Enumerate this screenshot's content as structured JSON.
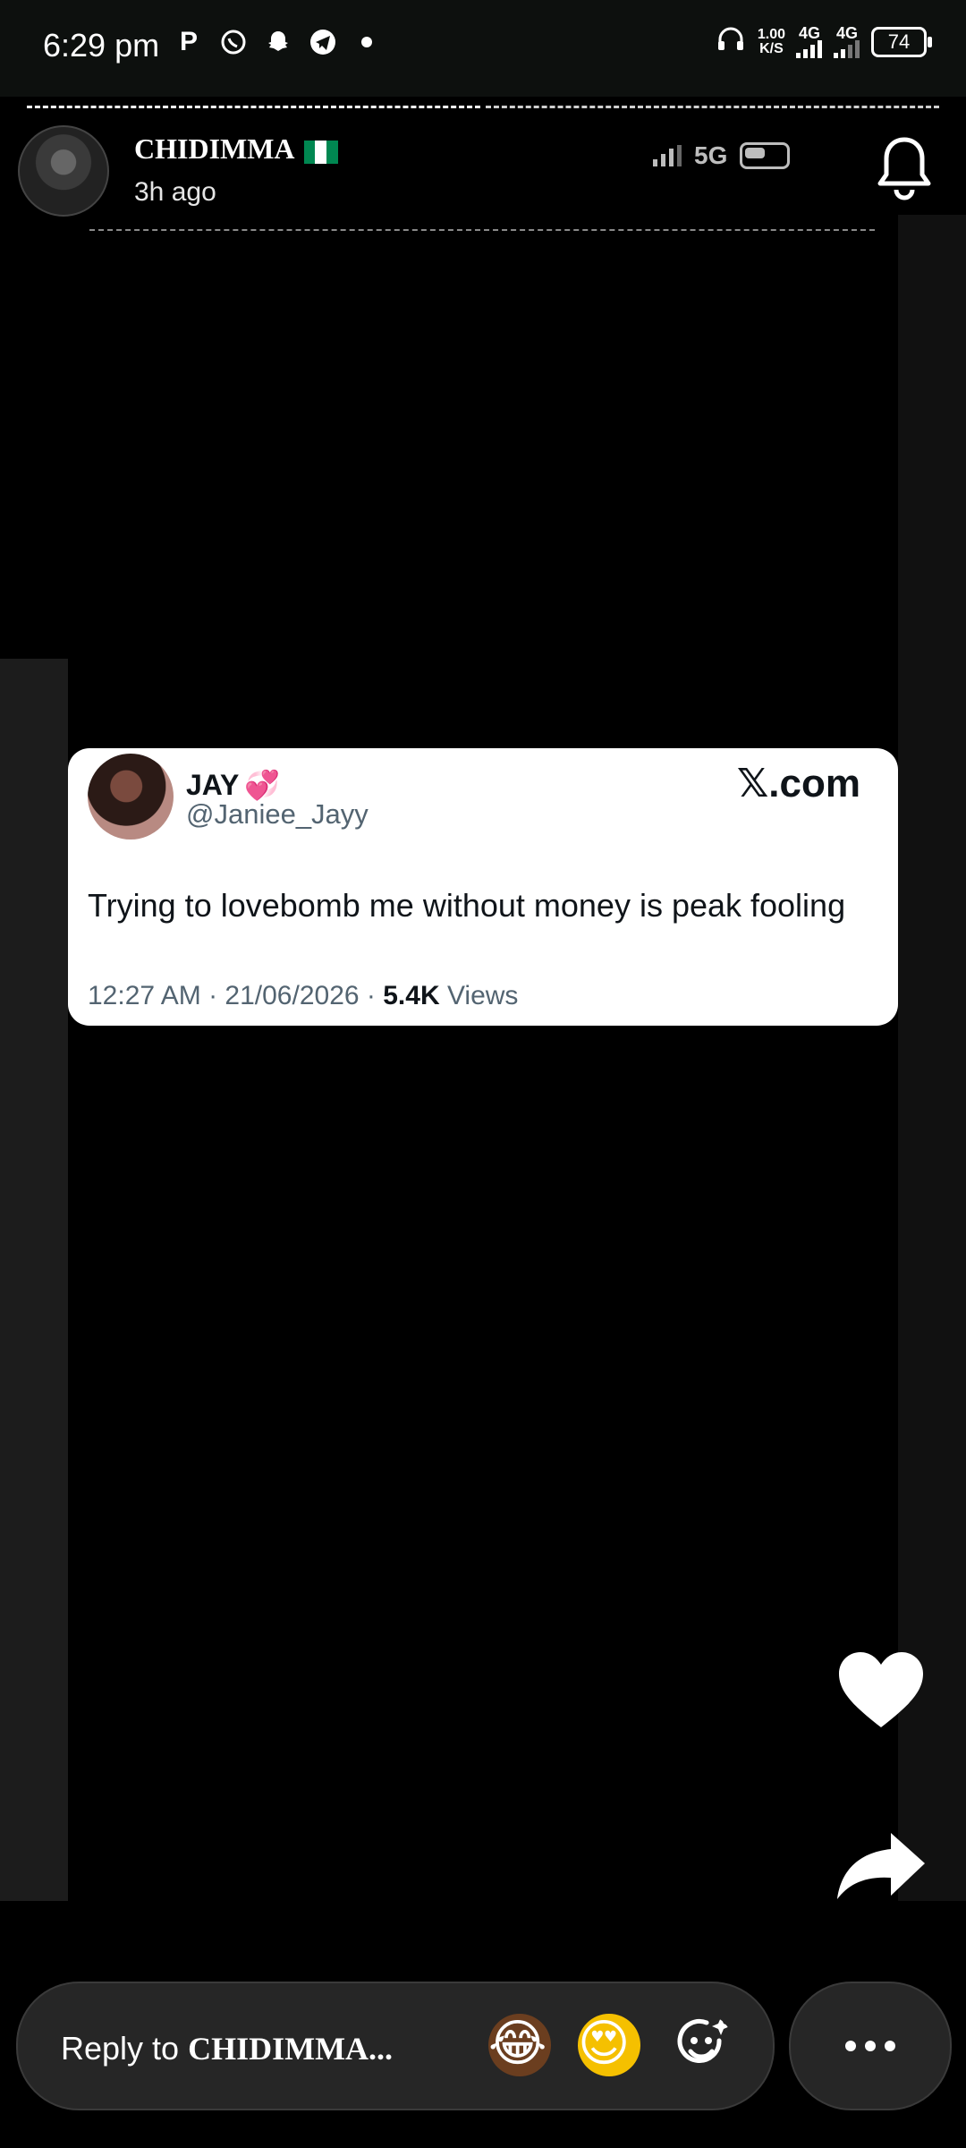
{
  "status_bar": {
    "time": "6:29 pm",
    "speed_top": "1.00",
    "speed_bottom": "K/S",
    "net1": "4G",
    "net2": "4G",
    "battery": "74"
  },
  "story": {
    "author_name": "CHIDIMMA",
    "posted_time": "3h ago",
    "inner_network": "5G"
  },
  "tweet": {
    "name": "JAY",
    "handle": "@Janiee_Jayy",
    "brand": "𝕏.com",
    "text": "Trying to lovebomb me without money is peak fooling",
    "meta_time": "12:27 AM · 21/06/2026 · ",
    "views_count": "5.4K",
    "views_label": " Views"
  },
  "reply": {
    "prefix": "Reply to ",
    "name": "CHIDIMMA..."
  },
  "icons": {
    "like": "heart-icon",
    "share": "share-icon",
    "bell": "bell-icon",
    "more": "more-icon"
  }
}
